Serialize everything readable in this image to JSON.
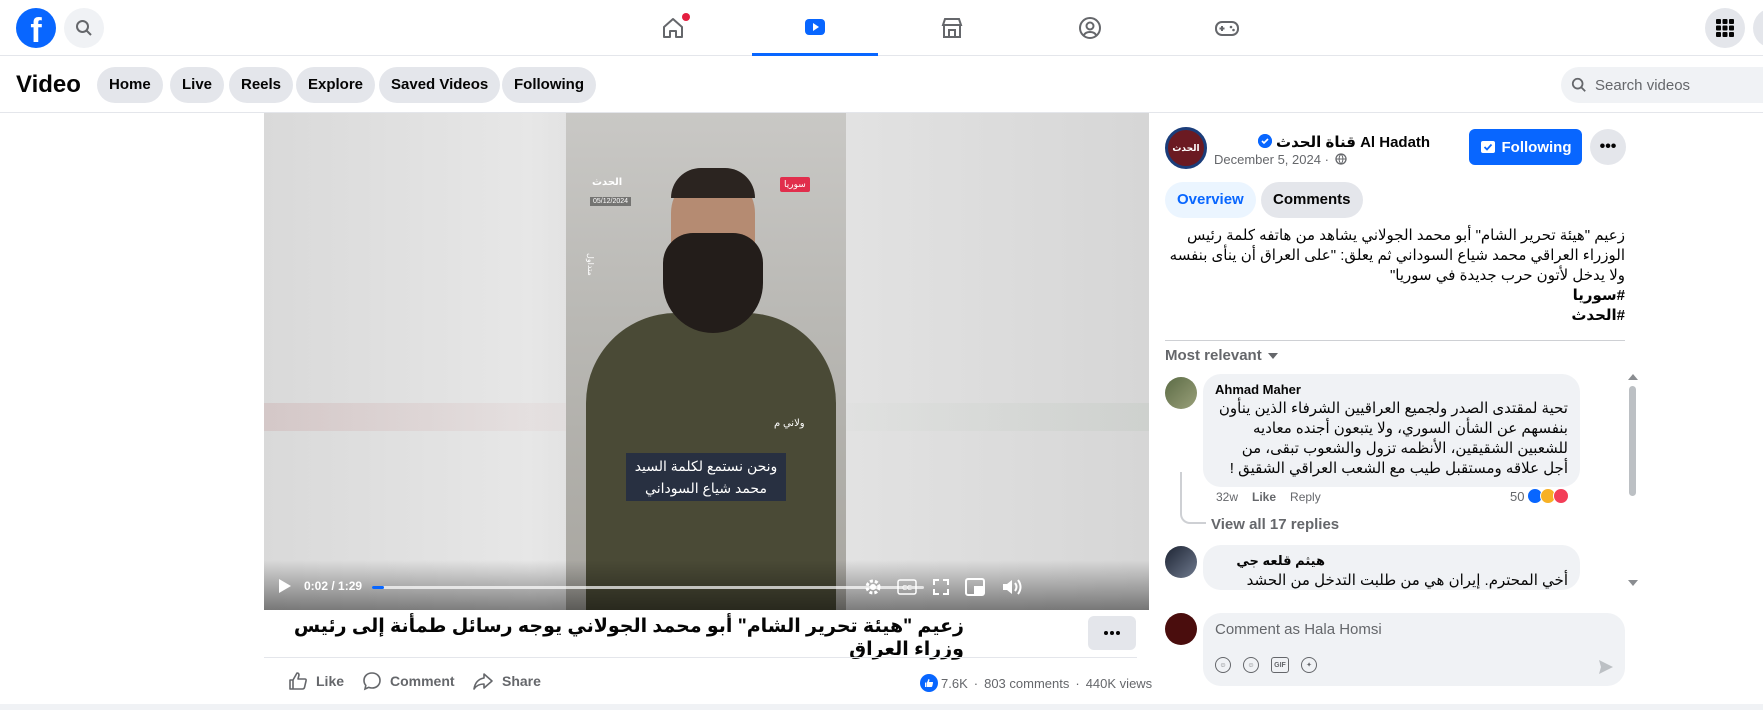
{
  "topnav": {
    "logo": "f",
    "tabs": [
      "home",
      "video",
      "marketplace",
      "groups",
      "gaming"
    ]
  },
  "subnav": {
    "title": "Video",
    "pills": [
      "Home",
      "Live",
      "Reels",
      "Explore",
      "Saved Videos",
      "Following"
    ],
    "search_placeholder": "Search videos"
  },
  "video": {
    "overlay_logo": "الحدث",
    "overlay_date": "05/12/2024",
    "overlay_country": "سوريا",
    "overlay_side": "متداول",
    "overlay_name": "ولاني م",
    "subtitle": "ونحن نستمع لكلمة السيد محمد شياع السوداني",
    "time": "0:02 / 1:29",
    "progress_fraction": 0.022
  },
  "post": {
    "title": "زعيم \"هيئة تحرير الشام\" أبو محمد الجولاني يوجه رسائل طمأنة إلى رئيس وزراء العراق",
    "actions": {
      "like": "Like",
      "comment": "Comment",
      "share": "Share"
    },
    "reactions": "7.6K",
    "comments_count": "803 comments",
    "views": "440K views"
  },
  "panel": {
    "avatar_label": "الحدث",
    "page_name": "قناة الحدث Al Hadath",
    "date": "December 5, 2024 ·",
    "follow_label": "Following",
    "more": "•••",
    "tabs": {
      "overview": "Overview",
      "comments": "Comments"
    },
    "description": "زعيم \"هيئة تحرير الشام\" أبو محمد الجولاني يشاهد من هاتفه كلمة رئيس الوزراء العراقي محمد شياع السوداني ثم يعلق: \"على العراق أن ينأى بنفسه ولا يدخل لأتون حرب جديدة في سوريا\"",
    "hashtags": [
      "#سوريا",
      "#الحدث"
    ],
    "sort_label": "Most relevant",
    "comments": [
      {
        "author": "Ahmad Maher",
        "text": "تحية لمقتدى الصدر ولجميع العراقيين الشرفاء الذين ينأون بنفسهم عن الشأن السوري، ولا يتبعون أجنده معاديه للشعبين الشقيقين، الأنظمه تزول والشعوب تبقى، من أجل علاقه ومستقبل طيب مع الشعب العراقي الشقيق !",
        "age": "32w",
        "like": "Like",
        "reply": "Reply",
        "reaction_count": "50"
      },
      {
        "author": "هيثم قلعه جي",
        "text": "أخي المحترم. إيران هي من طلبت التدخل من الحشد"
      }
    ],
    "view_replies": "View all 17 replies",
    "comment_placeholder": "Comment as Hala Homsi"
  },
  "colors": {
    "brand": "#0866ff",
    "surface": "#f0f2f5",
    "muted_text": "#65676b"
  }
}
